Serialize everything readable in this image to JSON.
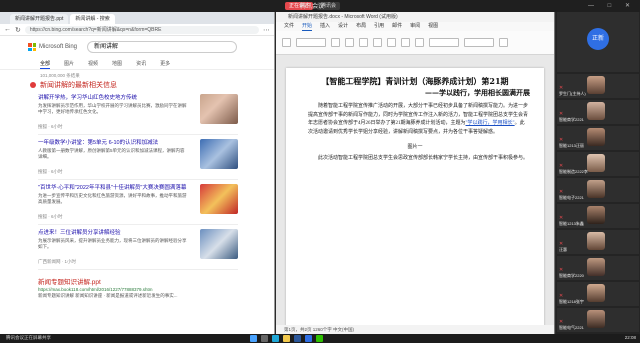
{
  "meeting": {
    "title": "腾讯会议",
    "share_status": "正在讲述",
    "share_viewer": "腾讯会",
    "window_controls": "— □ ✕"
  },
  "browser": {
    "tabs": [
      "新闻讲解开题报告.ppt",
      "新闻讲解 - 搜索"
    ],
    "address": "https://cn.bing.com/search?q=新闻讲解&qs=n&form=QBRE",
    "search_logo": "Microsoft Bing",
    "search_query": "新闻讲解",
    "scopes": [
      "全部",
      "图片",
      "视频",
      "地图",
      "资讯",
      "更多"
    ],
    "result_count": "101,000,000 条结果",
    "news_section_title": "新闻讲解的最新相关信息",
    "news": [
      {
        "title": "讲解开学热，学习华山红色校史地方传统",
        "desc": "为发挥讲解员示范作用，华山学校开展的学习讲解员比赛，激励同学在讲解中学习，更好地传承红色文化。",
        "source": "搜狐 · 6小时"
      },
      {
        "title": "一年级数学小讲堂：第5单元 6-10的认识和加减法",
        "desc": "人教版第一册数学讲解，原创讲解第5单元的认识和加减法课程，讲解内容详细。",
        "source": "搜狐 · 6小时"
      },
      {
        "title": "\"百世华·心平和\"2022年平和县\"十佳讲解员\"大赛决赛圆满落幕",
        "desc": "为进一步宣传平和历史文化和红色旅游资源，讲好平和故事，推动平和旅游高质量发展。",
        "source": "搜狐 · 6小时"
      },
      {
        "title": "点进来！三位讲解员分享讲解经验",
        "desc": "为展示讲解员风采，提升讲解员业务能力，现将三位讲解员的讲解经验分享如下。",
        "source": "广西新闻网 · 1小时"
      }
    ],
    "ppt_link": "新闻专题知识讲解.ppt",
    "ppt_url": "https://max.book118.com/html/2016/1227/77888379.shtm",
    "ppt_desc": "新闻专题知识讲解 新闻知识讲座 · 新闻是报道或评述新近发生的事实..."
  },
  "word": {
    "title": "新闻讲解开题报告.docx - Microsoft Word (试用版)",
    "ribbon_tabs": [
      "文件",
      "开始",
      "插入",
      "设计",
      "布局",
      "引用",
      "邮件",
      "审阅",
      "视图"
    ],
    "doc_title": "【智能工程学院】青训计划（海豚养成计划）第21期",
    "doc_subtitle": "——学以践行，学用相长圆满开展",
    "para1": "随着智能工程学院宣传推广活动的开展，大部分干事已经初步具备了新闻稿撰写能力。为进一步提高宣传部干事的新闻写作能力，同时为学院宣传工作注入新的活力，智能工程学院团总支学生会青年志愿者协会宣传部于4月26日举办了第21期海豚养成计划活动，主题为",
    "para1_link": "\"学以践行，学用相长\"",
    "para1_tail": "。此次活动邀请到优秀学长学姐分享经验，讲解新闻稿撰写要点，并为各位干事答疑解惑。",
    "image_label": "图片一",
    "para2": "此次活动智能工程学院团总支学生会思政宣传部部长韩家宁学长主持，由宣传部干事积极参与。",
    "status": "第1页，共2页  1260个字  中文(中国)"
  },
  "participants": [
    {
      "name": "正新",
      "self": true
    },
    {
      "name": "罗生门(主持人)"
    },
    {
      "name": "智能商学2221"
    },
    {
      "name": "智能1213汪丽"
    },
    {
      "name": "智能制造2222李"
    },
    {
      "name": "智能电子2221"
    },
    {
      "name": "智能1213朱鑫"
    },
    {
      "name": "汪惠"
    },
    {
      "name": "智能商学2220"
    },
    {
      "name": "智能1218张宇"
    },
    {
      "name": "智能电气2221"
    }
  ],
  "taskbar": {
    "left_text": "腾讯会议正在屏幕共享",
    "clock": "22:08"
  },
  "colors": {
    "accent_red": "#e5484d",
    "bing_blue": "#174ae4",
    "word_blue": "#185abd"
  }
}
